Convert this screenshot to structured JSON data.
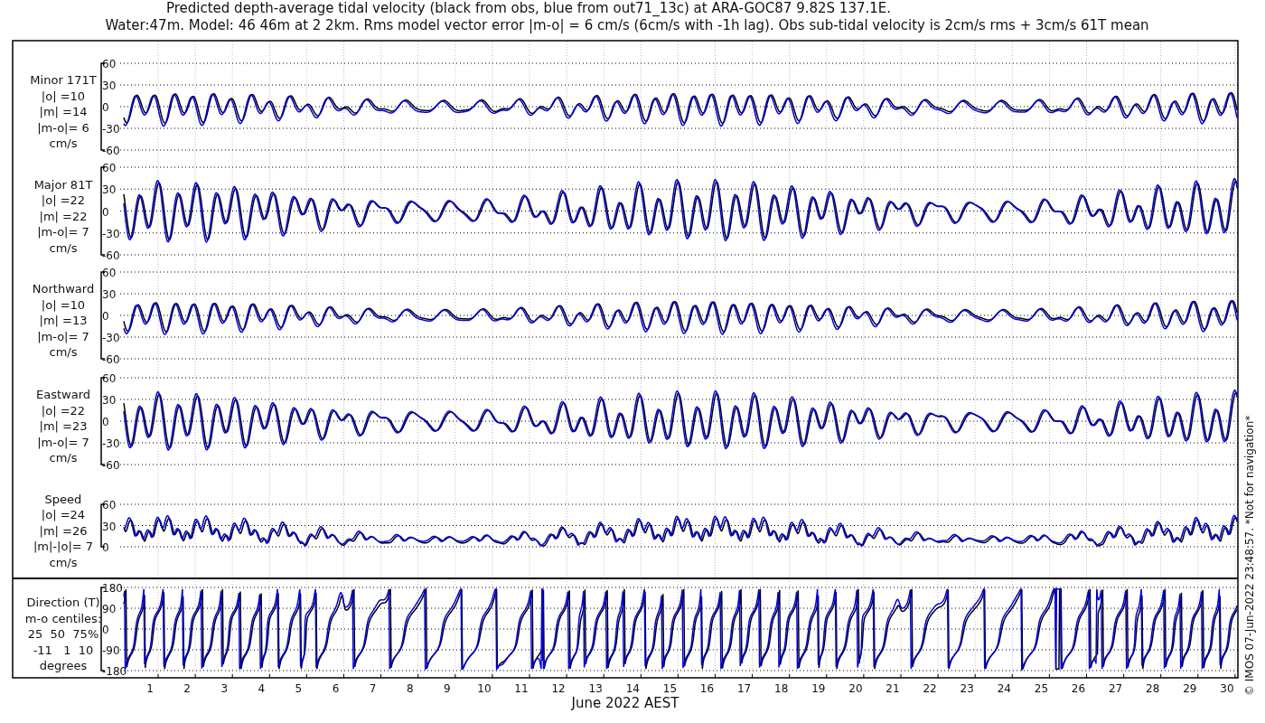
{
  "title": {
    "line_1": "Predicted depth-average tidal velocity (black from obs, blue from out71_13c) at ARA-GOC87 9.82S 137.1E.",
    "line_2": "Water:47m. Model: 46 46m at 2 2km. Rms model vector error |m-o| = 6 cm/s (6cm/s with -1h lag). Obs sub-tidal velocity is 2cm/s rms + 3cm/s 61T mean"
  },
  "panels": [
    {
      "kind": "minor",
      "label_lines": [
        "Minor 171T",
        "|o| =10",
        "|m| =14",
        "|m-o|= 6",
        "cm/s"
      ],
      "yticks": [
        "60",
        "30",
        "0",
        "-30",
        "-60"
      ]
    },
    {
      "kind": "major",
      "label_lines": [
        "Major 81T",
        "|o| =22",
        "|m| =22",
        "|m-o|= 7",
        "cm/s"
      ],
      "yticks": [
        "60",
        "30",
        "0",
        "-30",
        "-60"
      ]
    },
    {
      "kind": "northward",
      "label_lines": [
        "Northward",
        "|o| =10",
        "|m| =13",
        "|m-o|= 7",
        "cm/s"
      ],
      "yticks": [
        "60",
        "30",
        "0",
        "-30",
        "-60"
      ]
    },
    {
      "kind": "eastward",
      "label_lines": [
        "Eastward",
        "|o| =22",
        "|m| =23",
        "|m-o|= 7",
        "cm/s"
      ],
      "yticks": [
        "60",
        "30",
        "0",
        "-30",
        "-60"
      ]
    },
    {
      "kind": "speed",
      "label_lines": [
        "Speed",
        "|o| =24",
        "|m| =26",
        "|m|-|o|= 7",
        "cm/s"
      ],
      "yticks": [
        "60",
        "30",
        "0"
      ]
    },
    {
      "kind": "direction",
      "label_lines": [
        "Direction (T)",
        "m-o centiles:",
        "25  50  75%",
        "-11   1  10",
        "degrees"
      ],
      "yticks": [
        "180",
        "90",
        "0",
        "-90",
        "-180"
      ]
    }
  ],
  "x_axis": {
    "ticks": [
      "1",
      "2",
      "3",
      "4",
      "5",
      "6",
      "7",
      "8",
      "9",
      "10",
      "11",
      "12",
      "13",
      "14",
      "15",
      "16",
      "17",
      "18",
      "19",
      "20",
      "21",
      "22",
      "23",
      "24",
      "25",
      "26",
      "27",
      "28",
      "29",
      "30"
    ],
    "label": "June 2022 AEST"
  },
  "side_note": "© IMOS 07-Jun-2022 23:48:57. *Not for navigation*"
}
